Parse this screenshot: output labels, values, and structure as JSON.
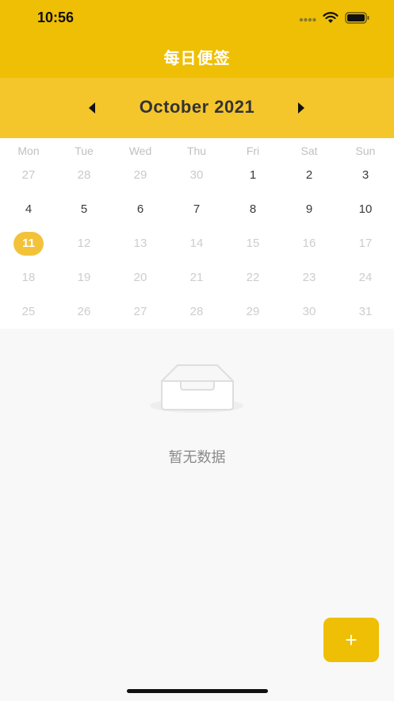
{
  "status_bar": {
    "time": "10:56"
  },
  "header": {
    "title": "每日便签"
  },
  "calendar": {
    "month_label": "October 2021",
    "weekdays": [
      "Mon",
      "Tue",
      "Wed",
      "Thu",
      "Fri",
      "Sat",
      "Sun"
    ],
    "weeks": [
      [
        {
          "d": "27",
          "t": "other"
        },
        {
          "d": "28",
          "t": "other"
        },
        {
          "d": "29",
          "t": "other"
        },
        {
          "d": "30",
          "t": "other"
        },
        {
          "d": "1",
          "t": "cur"
        },
        {
          "d": "2",
          "t": "cur"
        },
        {
          "d": "3",
          "t": "cur"
        }
      ],
      [
        {
          "d": "4",
          "t": "cur"
        },
        {
          "d": "5",
          "t": "cur"
        },
        {
          "d": "6",
          "t": "cur"
        },
        {
          "d": "7",
          "t": "cur"
        },
        {
          "d": "8",
          "t": "cur"
        },
        {
          "d": "9",
          "t": "cur"
        },
        {
          "d": "10",
          "t": "cur"
        }
      ],
      [
        {
          "d": "11",
          "t": "today"
        },
        {
          "d": "12",
          "t": "muted"
        },
        {
          "d": "13",
          "t": "muted"
        },
        {
          "d": "14",
          "t": "muted"
        },
        {
          "d": "15",
          "t": "muted"
        },
        {
          "d": "16",
          "t": "muted"
        },
        {
          "d": "17",
          "t": "muted"
        }
      ],
      [
        {
          "d": "18",
          "t": "muted"
        },
        {
          "d": "19",
          "t": "muted"
        },
        {
          "d": "20",
          "t": "muted"
        },
        {
          "d": "21",
          "t": "muted"
        },
        {
          "d": "22",
          "t": "muted"
        },
        {
          "d": "23",
          "t": "muted"
        },
        {
          "d": "24",
          "t": "muted"
        }
      ],
      [
        {
          "d": "25",
          "t": "muted"
        },
        {
          "d": "26",
          "t": "muted"
        },
        {
          "d": "27",
          "t": "muted"
        },
        {
          "d": "28",
          "t": "muted"
        },
        {
          "d": "29",
          "t": "muted"
        },
        {
          "d": "30",
          "t": "muted"
        },
        {
          "d": "31",
          "t": "muted"
        }
      ]
    ]
  },
  "empty_state": {
    "icon": "inbox-empty-icon",
    "text": "暂无数据"
  },
  "fab": {
    "label": "+"
  },
  "colors": {
    "primary": "#efbf05",
    "month_bar": "#f4c62c",
    "today": "#f2c33a"
  }
}
